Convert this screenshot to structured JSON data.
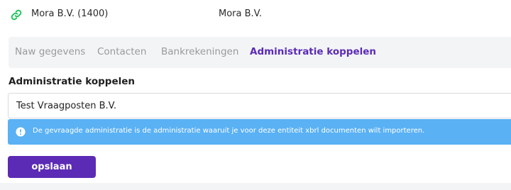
{
  "header": {
    "icon": "link-icon",
    "entity_name": "Mora B.V. (1400)",
    "entity_name_short": "Mora B.V."
  },
  "tabs": [
    {
      "label": "Naw gegevens",
      "active": false
    },
    {
      "label": "Contacten",
      "active": false
    },
    {
      "label": "Bankrekeningen",
      "active": false
    },
    {
      "label": "Administratie koppelen",
      "active": true
    }
  ],
  "section": {
    "title": "Administratie koppelen",
    "selected_value": "Test Vraagposten B.V."
  },
  "alert": {
    "icon": "exclamation-circle-icon",
    "text": "De gevraagde administratie is de administratie waaruit je voor deze entiteit xbrl documenten wilt importeren."
  },
  "actions": {
    "save_label": "opslaan"
  },
  "colors": {
    "accent": "#5b2bb5",
    "alert_bg": "#5ab2f5",
    "link_icon": "#22c55e"
  }
}
